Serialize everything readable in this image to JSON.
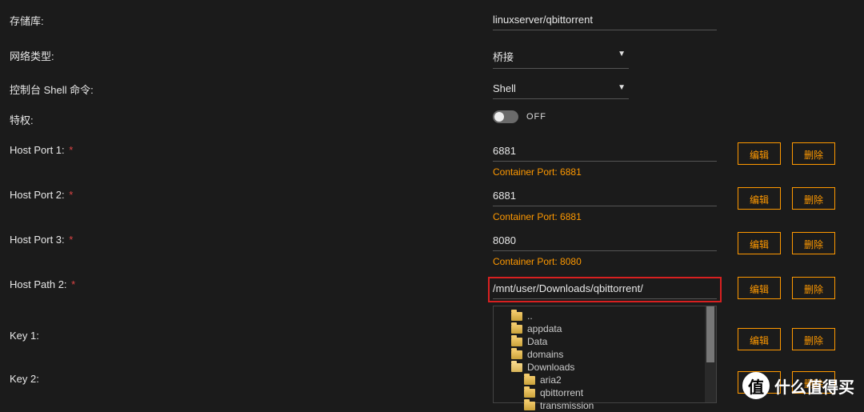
{
  "labels": {
    "repository": "存储库:",
    "network": "网络类型:",
    "console": "控制台 Shell 命令:",
    "privilege": "特权:",
    "hostPort1": "Host Port 1:",
    "hostPort2": "Host Port 2:",
    "hostPort3": "Host Port 3:",
    "hostPath2": "Host Path 2:",
    "key1": "Key 1:",
    "key2": "Key 2:",
    "required": "*"
  },
  "values": {
    "repository": "linuxserver/qbittorrent",
    "network": "桥接",
    "console": "Shell",
    "privilegeToggle": "OFF",
    "port1": "6881",
    "port1sub": "Container Port: 6881",
    "port2": "6881",
    "port2sub": "Container Port: 6881",
    "port3": "8080",
    "port3sub": "Container Port: 8080",
    "path2": "/mnt/user/Downloads/qbittorrent/"
  },
  "buttons": {
    "edit": "编辑",
    "delete": "删除"
  },
  "tree": {
    "up": "..",
    "items": [
      {
        "name": "appdata",
        "level": 1,
        "open": false
      },
      {
        "name": "Data",
        "level": 1,
        "open": false
      },
      {
        "name": "domains",
        "level": 1,
        "open": false
      },
      {
        "name": "Downloads",
        "level": 1,
        "open": true
      },
      {
        "name": "aria2",
        "level": 2,
        "open": false
      },
      {
        "name": "qbittorrent",
        "level": 2,
        "open": false
      },
      {
        "name": "transmission",
        "level": 2,
        "open": false
      }
    ]
  },
  "watermark": {
    "badge": "值",
    "text": "什么值得买"
  }
}
